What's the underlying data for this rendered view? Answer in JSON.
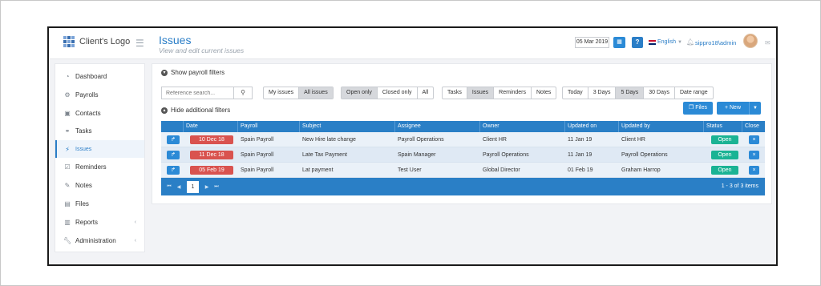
{
  "app": {
    "logo_text": "Client's Logo",
    "page_title": "Issues",
    "page_subtitle": "View and edit current issues",
    "date": "05 Mar 2019",
    "language": "English",
    "user": "sippro18\\admin",
    "accent_color": "#2b7ec7"
  },
  "sidebar": {
    "items": [
      {
        "label": "Dashboard",
        "icon": "dashboard-icon"
      },
      {
        "label": "Payrolls",
        "icon": "cogs-icon"
      },
      {
        "label": "Contacts",
        "icon": "contact-card-icon"
      },
      {
        "label": "Tasks",
        "icon": "tasks-icon"
      },
      {
        "label": "Issues",
        "icon": "bolt-icon",
        "active": true
      },
      {
        "label": "Reminders",
        "icon": "calendar-icon"
      },
      {
        "label": "Notes",
        "icon": "notes-icon"
      },
      {
        "label": "Files",
        "icon": "file-icon"
      },
      {
        "label": "Reports",
        "icon": "reports-icon",
        "expandable": true
      },
      {
        "label": "Administration",
        "icon": "wrench-icon",
        "expandable": true
      }
    ]
  },
  "filters": {
    "show_payroll_filters": "Show payroll filters",
    "hide_additional_filters": "Hide additional filters",
    "search_placeholder": "Reference search...",
    "scope": [
      "My issues",
      "All issues"
    ],
    "scope_selected": "All issues",
    "state": [
      "Open only",
      "Closed only",
      "All"
    ],
    "state_selected": "Open only",
    "types": [
      "Tasks",
      "Issues",
      "Reminders",
      "Notes"
    ],
    "types_selected": "Issues",
    "range": [
      "Today",
      "3 Days",
      "5 Days",
      "30 Days",
      "Date range"
    ],
    "range_selected": "5 Days"
  },
  "actions": {
    "files_label": "Files",
    "new_label": "+ New"
  },
  "grid": {
    "columns": [
      "",
      "Date",
      "Payroll",
      "Subject",
      "Assignee",
      "Owner",
      "Updated on",
      "Updated by",
      "Status",
      "Close"
    ],
    "rows": [
      {
        "date": "10 Dec 18",
        "payroll": "Spain Payroll",
        "subject": "New Hire late change",
        "assignee": "Payroll Operations",
        "owner": "Client HR",
        "updated_on": "11 Jan 19",
        "updated_by": "Client HR",
        "status": "Open"
      },
      {
        "date": "11 Dec 18",
        "payroll": "Spain Payroll",
        "subject": "Late Tax Payment",
        "assignee": "Spain Manager",
        "owner": "Payroll Operations",
        "updated_on": "11 Jan 19",
        "updated_by": "Payroll Operations",
        "status": "Open"
      },
      {
        "date": "05 Feb 19",
        "payroll": "Spain Payroll",
        "subject": "Lat payment",
        "assignee": "Test User",
        "owner": "Global Director",
        "updated_on": "01 Feb 19",
        "updated_by": "Graham Harrop",
        "status": "Open"
      }
    ],
    "close_symbol": "×",
    "current_page": "1",
    "pager_info": "1 - 3 of 3 items",
    "overdue_color": "#d9534f",
    "status_color": "#1ab394"
  }
}
